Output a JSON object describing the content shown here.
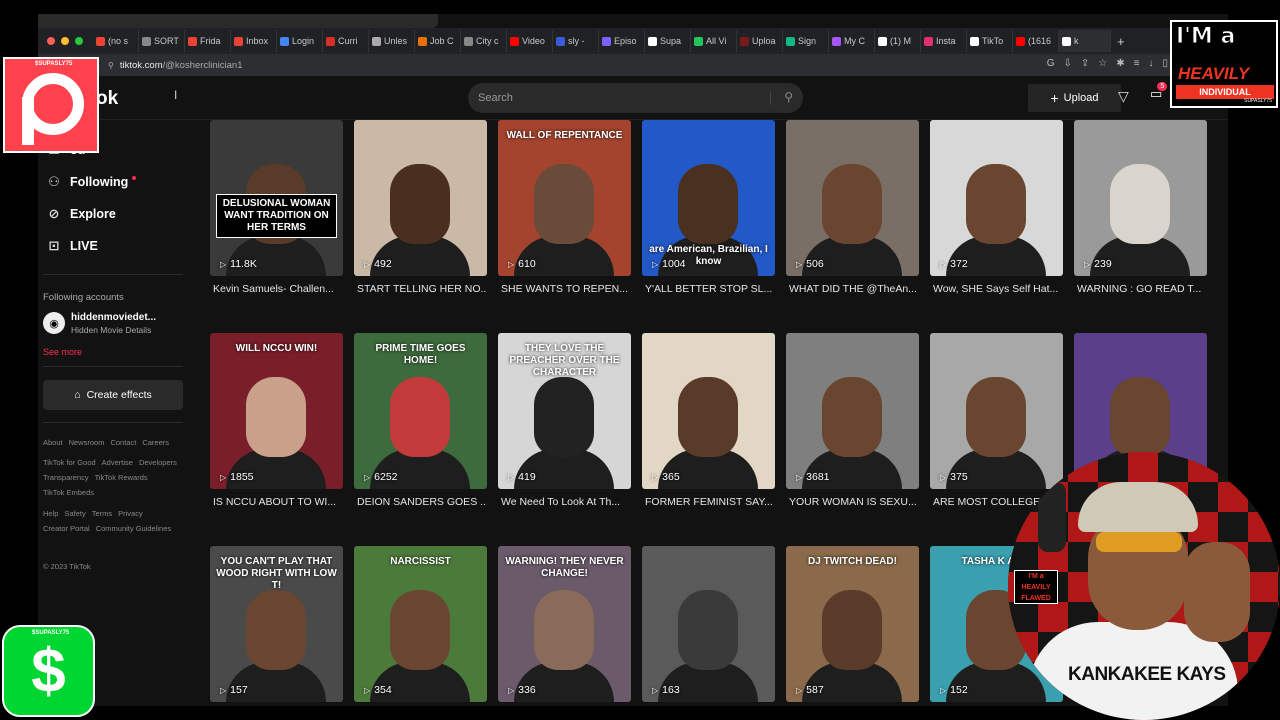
{
  "browser": {
    "tabs": [
      {
        "label": "(no s",
        "color": "#ea4335"
      },
      {
        "label": "SORT",
        "color": "#888888"
      },
      {
        "label": "Frida",
        "color": "#ea4335"
      },
      {
        "label": "Inbox",
        "color": "#ea4335"
      },
      {
        "label": "Login",
        "color": "#4285f4"
      },
      {
        "label": "Curri",
        "color": "#d93025"
      },
      {
        "label": "Unles",
        "color": "#aaaaaa"
      },
      {
        "label": "Job C",
        "color": "#e8710a"
      },
      {
        "label": "City c",
        "color": "#888888"
      },
      {
        "label": "Video",
        "color": "#ff0000"
      },
      {
        "label": "sly -",
        "color": "#3b5bdb"
      },
      {
        "label": "Episo",
        "color": "#7b61ff"
      },
      {
        "label": "Supa",
        "color": "#ffffff"
      },
      {
        "label": "All Vi",
        "color": "#22c55e"
      },
      {
        "label": "Uploa",
        "color": "#7a1a1a"
      },
      {
        "label": "Sign",
        "color": "#10b981"
      },
      {
        "label": "My C",
        "color": "#a855f7"
      },
      {
        "label": "(1) M",
        "color": "#ffffff"
      },
      {
        "label": "Insta",
        "color": "#e1306c"
      },
      {
        "label": "TikTo",
        "color": "#ffffff"
      },
      {
        "label": "(1616",
        "color": "#ff0000"
      },
      {
        "label": "k",
        "color": "#ffffff"
      }
    ],
    "url_host": "tiktok.com",
    "url_path": "/@kosherclinician1"
  },
  "header": {
    "logo": "ok",
    "search_placeholder": "Search",
    "upload_label": "Upload",
    "inbox_count": "5"
  },
  "sidebar": {
    "nav": [
      {
        "label": "ou",
        "icon": "person-icon"
      },
      {
        "label": "Following",
        "icon": "following-icon"
      },
      {
        "label": "Explore",
        "icon": "explore-icon"
      },
      {
        "label": "LIVE",
        "icon": "live-icon"
      }
    ],
    "following_title": "Following accounts",
    "account_username": "hiddenmoviedet...",
    "account_name": "Hidden Movie Details",
    "see_more": "See more",
    "create_effects": "Create effects",
    "footer1": [
      "About",
      "Newsroom",
      "Contact",
      "Careers"
    ],
    "footer2": [
      "TikTok for Good",
      "Advertise",
      "Developers",
      "Transparency",
      "TikTok Rewards",
      "TikTok Embeds"
    ],
    "footer3": [
      "Help",
      "Safety",
      "Terms",
      "Privacy",
      "Creator Portal",
      "Community Guidelines"
    ],
    "copyright": "© 2023 TikTok"
  },
  "videos": [
    {
      "views": "11.8K",
      "title": "Kevin Samuels- Challen...",
      "overlay": "DELUSIONAL WOMAN WANT TRADITION ON HER TERMS",
      "bg": "#3a3a3a",
      "skin": "#5a3a28"
    },
    {
      "views": "492",
      "title": "START TELLING HER NO...",
      "overlay": "",
      "bg": "#c9b9a6",
      "skin": "#4a2e20"
    },
    {
      "views": "610",
      "title": "SHE WANTS TO REPEN...",
      "overlay": "WALL OF REPENTANCE",
      "bg": "#a4442e",
      "skin": "#6a4a38"
    },
    {
      "views": "1004",
      "title": "Y'ALL BETTER STOP SL...",
      "overlay": "are American, Brazilian, I know",
      "bg": "#2358c7",
      "skin": "#4a3020"
    },
    {
      "views": "506",
      "title": "WHAT DID THE @TheAn...",
      "overlay": "",
      "bg": "#7a6f66",
      "skin": "#6a4630"
    },
    {
      "views": "372",
      "title": "Wow, SHE Says Self Hat...",
      "overlay": "",
      "bg": "#d8d8d8",
      "skin": "#6a4630"
    },
    {
      "views": "239",
      "title": "WARNING : GO READ T...",
      "overlay": "",
      "bg": "#9a9a9a",
      "skin": "#d9d5cc"
    },
    {
      "views": "1855",
      "title": "IS NCCU ABOUT TO WI...",
      "overlay": "WILL NCCU WIN!",
      "bg": "#7a1e2a",
      "skin": "#c9a08a"
    },
    {
      "views": "6252",
      "title": "DEION SANDERS GOES ...",
      "overlay": "PRIME TIME GOES HOME!",
      "bg": "#3d6b3d",
      "skin": "#c23a3a"
    },
    {
      "views": "419",
      "title": "We Need To Look At Th...",
      "overlay": "THEY LOVE THE PREACHER OVER THE CHARACTER",
      "bg": "#d6d6d6",
      "skin": "#222222"
    },
    {
      "views": "365",
      "title": "FORMER FEMINIST SAY...",
      "overlay": "",
      "bg": "#e2d6c4",
      "skin": "#5a3a28"
    },
    {
      "views": "3681",
      "title": "YOUR WOMAN IS SEXU...",
      "overlay": "",
      "bg": "#7f7f7f",
      "skin": "#6a4630"
    },
    {
      "views": "375",
      "title": "ARE MOST COLLEGE",
      "overlay": "",
      "bg": "#a8a8a8",
      "skin": "#6a4630"
    },
    {
      "views": "",
      "title": "",
      "overlay": "",
      "bg": "#5b3f8a",
      "skin": "#6a4630"
    },
    {
      "views": "157",
      "title": "",
      "overlay": "YOU CAN'T PLAY THAT WOOD RIGHT WITH LOW T!",
      "bg": "#4a4a4a",
      "skin": "#6a4630"
    },
    {
      "views": "354",
      "title": "",
      "overlay": "NARCISSIST",
      "bg": "#4c7a3a",
      "skin": "#6a4630"
    },
    {
      "views": "336",
      "title": "",
      "overlay": "WARNING! THEY NEVER CHANGE!",
      "bg": "#6a5a6a",
      "skin": "#8a6a5a"
    },
    {
      "views": "163",
      "title": "",
      "overlay": "",
      "bg": "#5a5a5a",
      "skin": "#3a3a3a"
    },
    {
      "views": "587",
      "title": "",
      "overlay": "DJ TWITCH DEAD!",
      "bg": "#8a6a4a",
      "skin": "#5a3a28"
    },
    {
      "views": "152",
      "title": "",
      "overlay": "TASHA K AT IT",
      "bg": "#3aa0b0",
      "skin": "#6a4630"
    }
  ],
  "overlays": {
    "patreon_tag": "$SUPASLY75",
    "cashapp_tag": "$SUPASLY75",
    "flawed_line1": "I'M a",
    "flawed_line2": "HEAVILY FLAWED",
    "flawed_line3": "INDIVIDUAL",
    "flawed_sig": "SUPASLY75",
    "shirt_text": "KANKAKEE KAYS",
    "mini_logo": "I'M a HEAVILY FLAWED"
  },
  "colors": {
    "accent": "#fe2c55",
    "patreon": "#ff424d",
    "cashapp": "#00d632"
  }
}
